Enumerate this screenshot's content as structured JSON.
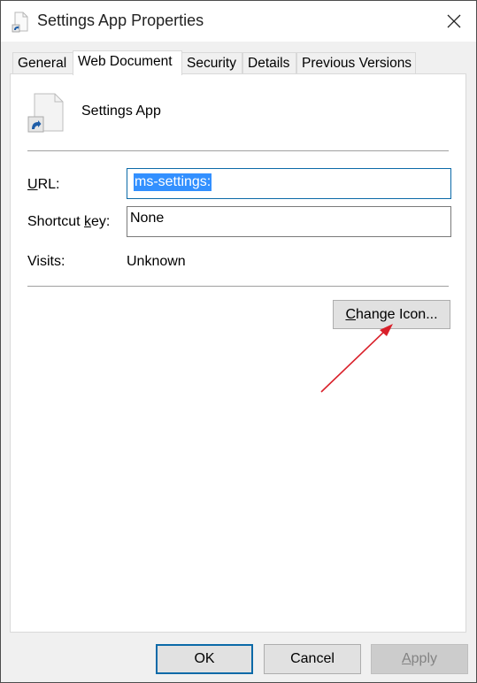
{
  "window": {
    "title": "Settings App Properties",
    "title_icon": "shortcut-file-icon",
    "close_icon": "close-icon"
  },
  "tabs": [
    {
      "label": "General",
      "active": false
    },
    {
      "label": "Web Document",
      "active": true
    },
    {
      "label": "Security",
      "active": false
    },
    {
      "label": "Details",
      "active": false
    },
    {
      "label": "Previous Versions",
      "active": false
    }
  ],
  "web_document": {
    "app_name": "Settings App",
    "url_label_accel": "U",
    "url_label_rest": "RL:",
    "url_value": "ms-settings:",
    "shortcut_label_pre": "Shortcut ",
    "shortcut_label_accel": "k",
    "shortcut_label_rest": "ey:",
    "shortcut_value": "None",
    "visits_label": "Visits:",
    "visits_value": "Unknown",
    "change_icon_accel": "C",
    "change_icon_rest": "hange Icon...",
    "annotation": "red-arrow pointing to Change Icon button"
  },
  "footer": {
    "ok_label": "OK",
    "cancel_label": "Cancel",
    "apply_accel": "A",
    "apply_rest": "pply"
  },
  "colors": {
    "selection": "#3390ff",
    "focus_border": "#0b6aa8",
    "arrow": "#d9202a"
  }
}
